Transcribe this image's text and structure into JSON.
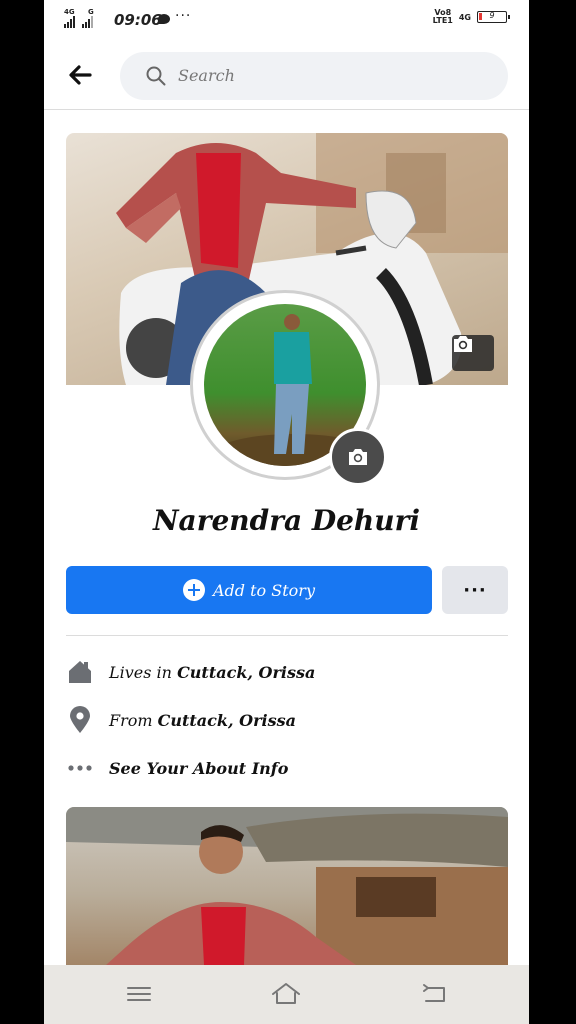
{
  "status_bar": {
    "network_left_1": "4G",
    "network_left_2": "G",
    "time": "09:06",
    "overflow": "···",
    "volte_line1": "Vo8",
    "volte_line2": "LTE1",
    "network_right": "4G",
    "battery_level": "9"
  },
  "header": {
    "search_placeholder": "Search"
  },
  "profile": {
    "name": "Narendra Dehuri",
    "add_story_label": "Add to Story",
    "more_label": "···"
  },
  "about": {
    "lives_prefix": "Lives in ",
    "lives_value": "Cuttack, Orissa",
    "from_prefix": "From ",
    "from_value": "Cuttack, Orissa",
    "see_about_label": "See Your About Info"
  },
  "colors": {
    "accent": "#1877f2",
    "secondary_button": "#e4e6eb",
    "search_bg": "#f0f2f5"
  },
  "icons": [
    "back-arrow-icon",
    "search-icon",
    "camera-icon",
    "plus-icon",
    "home-icon",
    "location-pin-icon",
    "more-dots-icon",
    "menu-icon",
    "home-nav-icon",
    "back-nav-icon"
  ]
}
